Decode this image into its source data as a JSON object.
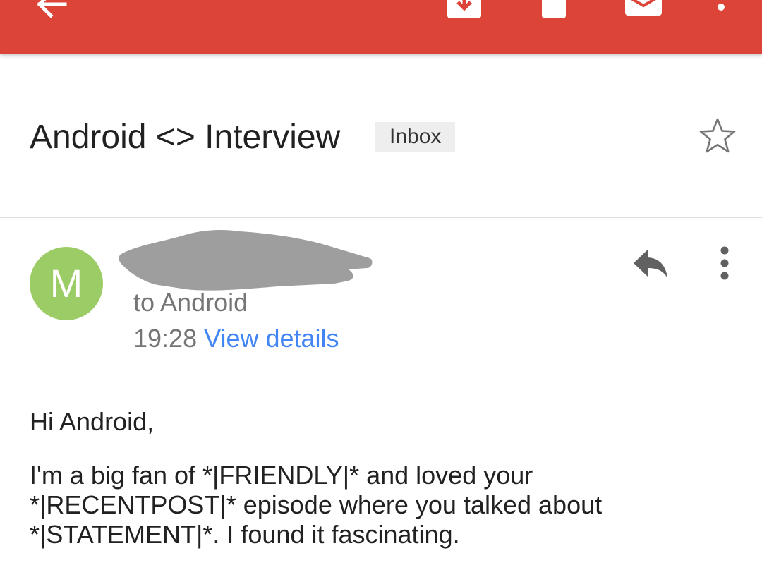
{
  "colors": {
    "app_bar": "#db4437",
    "avatar": "#9ccc65",
    "link": "#4285f4",
    "secondary_text": "#757575"
  },
  "toolbar": {
    "icons": [
      "back-arrow-icon",
      "archive-icon",
      "delete-icon",
      "mark-unread-icon",
      "more-vert-icon"
    ]
  },
  "thread": {
    "subject": "Android <> Interview",
    "label": "Inbox",
    "star_icon": "star-outline-icon"
  },
  "message": {
    "avatar_letter": "M",
    "recipient": "to Android",
    "time": "19:28",
    "details_link": "View details",
    "actions": [
      "reply-icon",
      "more-vert-icon"
    ]
  },
  "body": {
    "greeting": "Hi Android,",
    "paragraph": "I'm a big fan of *|FRIENDLY|* and loved your *|RECENTPOST|* episode where you talked about *|STATEMENT|*. I found it fascinating."
  }
}
